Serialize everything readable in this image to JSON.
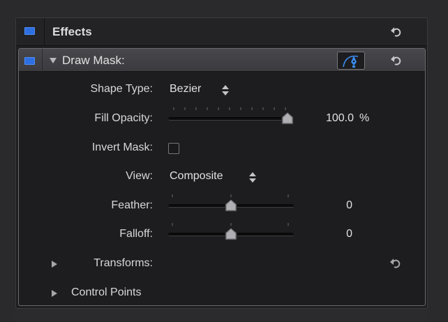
{
  "effects": {
    "title": "Effects",
    "enabled": true,
    "reset_icon": "reset-arrow-icon"
  },
  "draw_mask": {
    "title": "Draw Mask:",
    "enabled": true,
    "expanded": true,
    "pen_tool_icon": "pen-tool-icon",
    "reset_icon": "reset-arrow-icon",
    "accent_color": "#2d6fe0"
  },
  "shape_type": {
    "label": "Shape Type:",
    "value": "Bezier"
  },
  "fill_opacity": {
    "label": "Fill Opacity:",
    "value": "100.0",
    "unit": "%",
    "level": 1.0
  },
  "invert_mask": {
    "label": "Invert Mask:",
    "checked": false
  },
  "view": {
    "label": "View:",
    "value": "Composite"
  },
  "feather": {
    "label": "Feather:",
    "value": "0",
    "level": 0.5
  },
  "falloff": {
    "label": "Falloff:",
    "value": "0",
    "level": 0.5
  },
  "transforms": {
    "label": "Transforms:",
    "expanded": false
  },
  "control_points": {
    "label": "Control Points",
    "expanded": false
  }
}
